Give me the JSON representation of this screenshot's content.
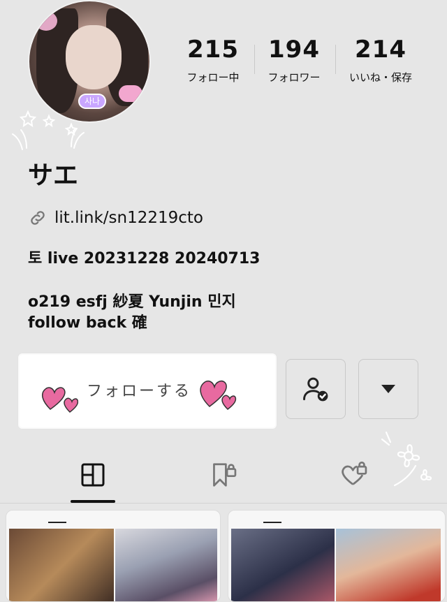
{
  "profile": {
    "display_name": "サエ",
    "avatar_tag": "사나",
    "link_text": "lit.link/sn12219cto",
    "bio_lines": [
      "토 live 20231228 20240713",
      "o219 esfj 紗夏 Yunjin 민지",
      "follow back 確"
    ]
  },
  "stats": [
    {
      "value": "215",
      "label": "フォロー中"
    },
    {
      "value": "194",
      "label": "フォロワー"
    },
    {
      "value": "214",
      "label": "いいね・保存"
    }
  ],
  "actions": {
    "follow_label": "フォローする",
    "friends_icon": "user-check-icon",
    "more_icon": "caret-down-icon"
  },
  "tabs": [
    {
      "icon": "grid-icon",
      "active": true
    },
    {
      "icon": "bookmark-lock-icon",
      "active": false
    },
    {
      "icon": "heart-lock-icon",
      "active": false
    }
  ],
  "colors": {
    "background": "#e6e6e6",
    "heart_pink": "#e86aa0",
    "text": "#111111"
  }
}
